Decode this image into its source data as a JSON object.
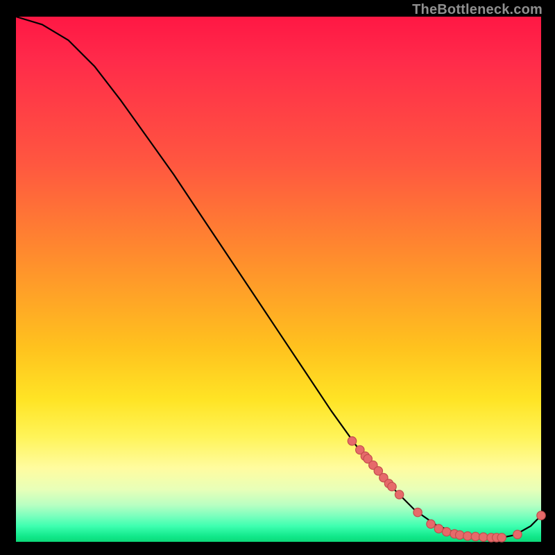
{
  "watermark": "TheBottleneck.com",
  "chart_data": {
    "type": "line",
    "note": "Axes are unlabeled and ticks are not shown; values are normalized 0–100 estimated from pixel positions. Curve descends from top-left, bottoms out ~x=80–92, then rises slightly at far right. Salmon dots mark samples along the lower-right portion of the curve.",
    "xlim": [
      0,
      100
    ],
    "ylim": [
      0,
      100
    ],
    "series": [
      {
        "name": "curve",
        "x": [
          0,
          5,
          10,
          15,
          20,
          25,
          30,
          35,
          40,
          45,
          50,
          55,
          60,
          65,
          70,
          73,
          76,
          80,
          84,
          88,
          92,
          95,
          98,
          100
        ],
        "y": [
          100,
          98.5,
          95.5,
          90.5,
          84,
          77,
          70,
          62.5,
          55,
          47.5,
          40,
          32.5,
          25,
          18,
          12,
          9,
          6,
          3.2,
          1.6,
          0.9,
          0.7,
          1.3,
          3.0,
          5.0
        ]
      }
    ],
    "points": {
      "name": "markers",
      "x": [
        64,
        65.5,
        66.5,
        67,
        68,
        69,
        70,
        71,
        71.6,
        73,
        76.5,
        79,
        80.5,
        82,
        83.5,
        84.5,
        86,
        87.5,
        89,
        90.5,
        91.5,
        92.5,
        95.5,
        100
      ],
      "y": [
        19.2,
        17.5,
        16.3,
        15.8,
        14.6,
        13.5,
        12.2,
        11.1,
        10.5,
        9.0,
        5.6,
        3.4,
        2.5,
        1.9,
        1.5,
        1.3,
        1.1,
        1.0,
        0.9,
        0.8,
        0.8,
        0.8,
        1.4,
        5.0
      ]
    }
  }
}
